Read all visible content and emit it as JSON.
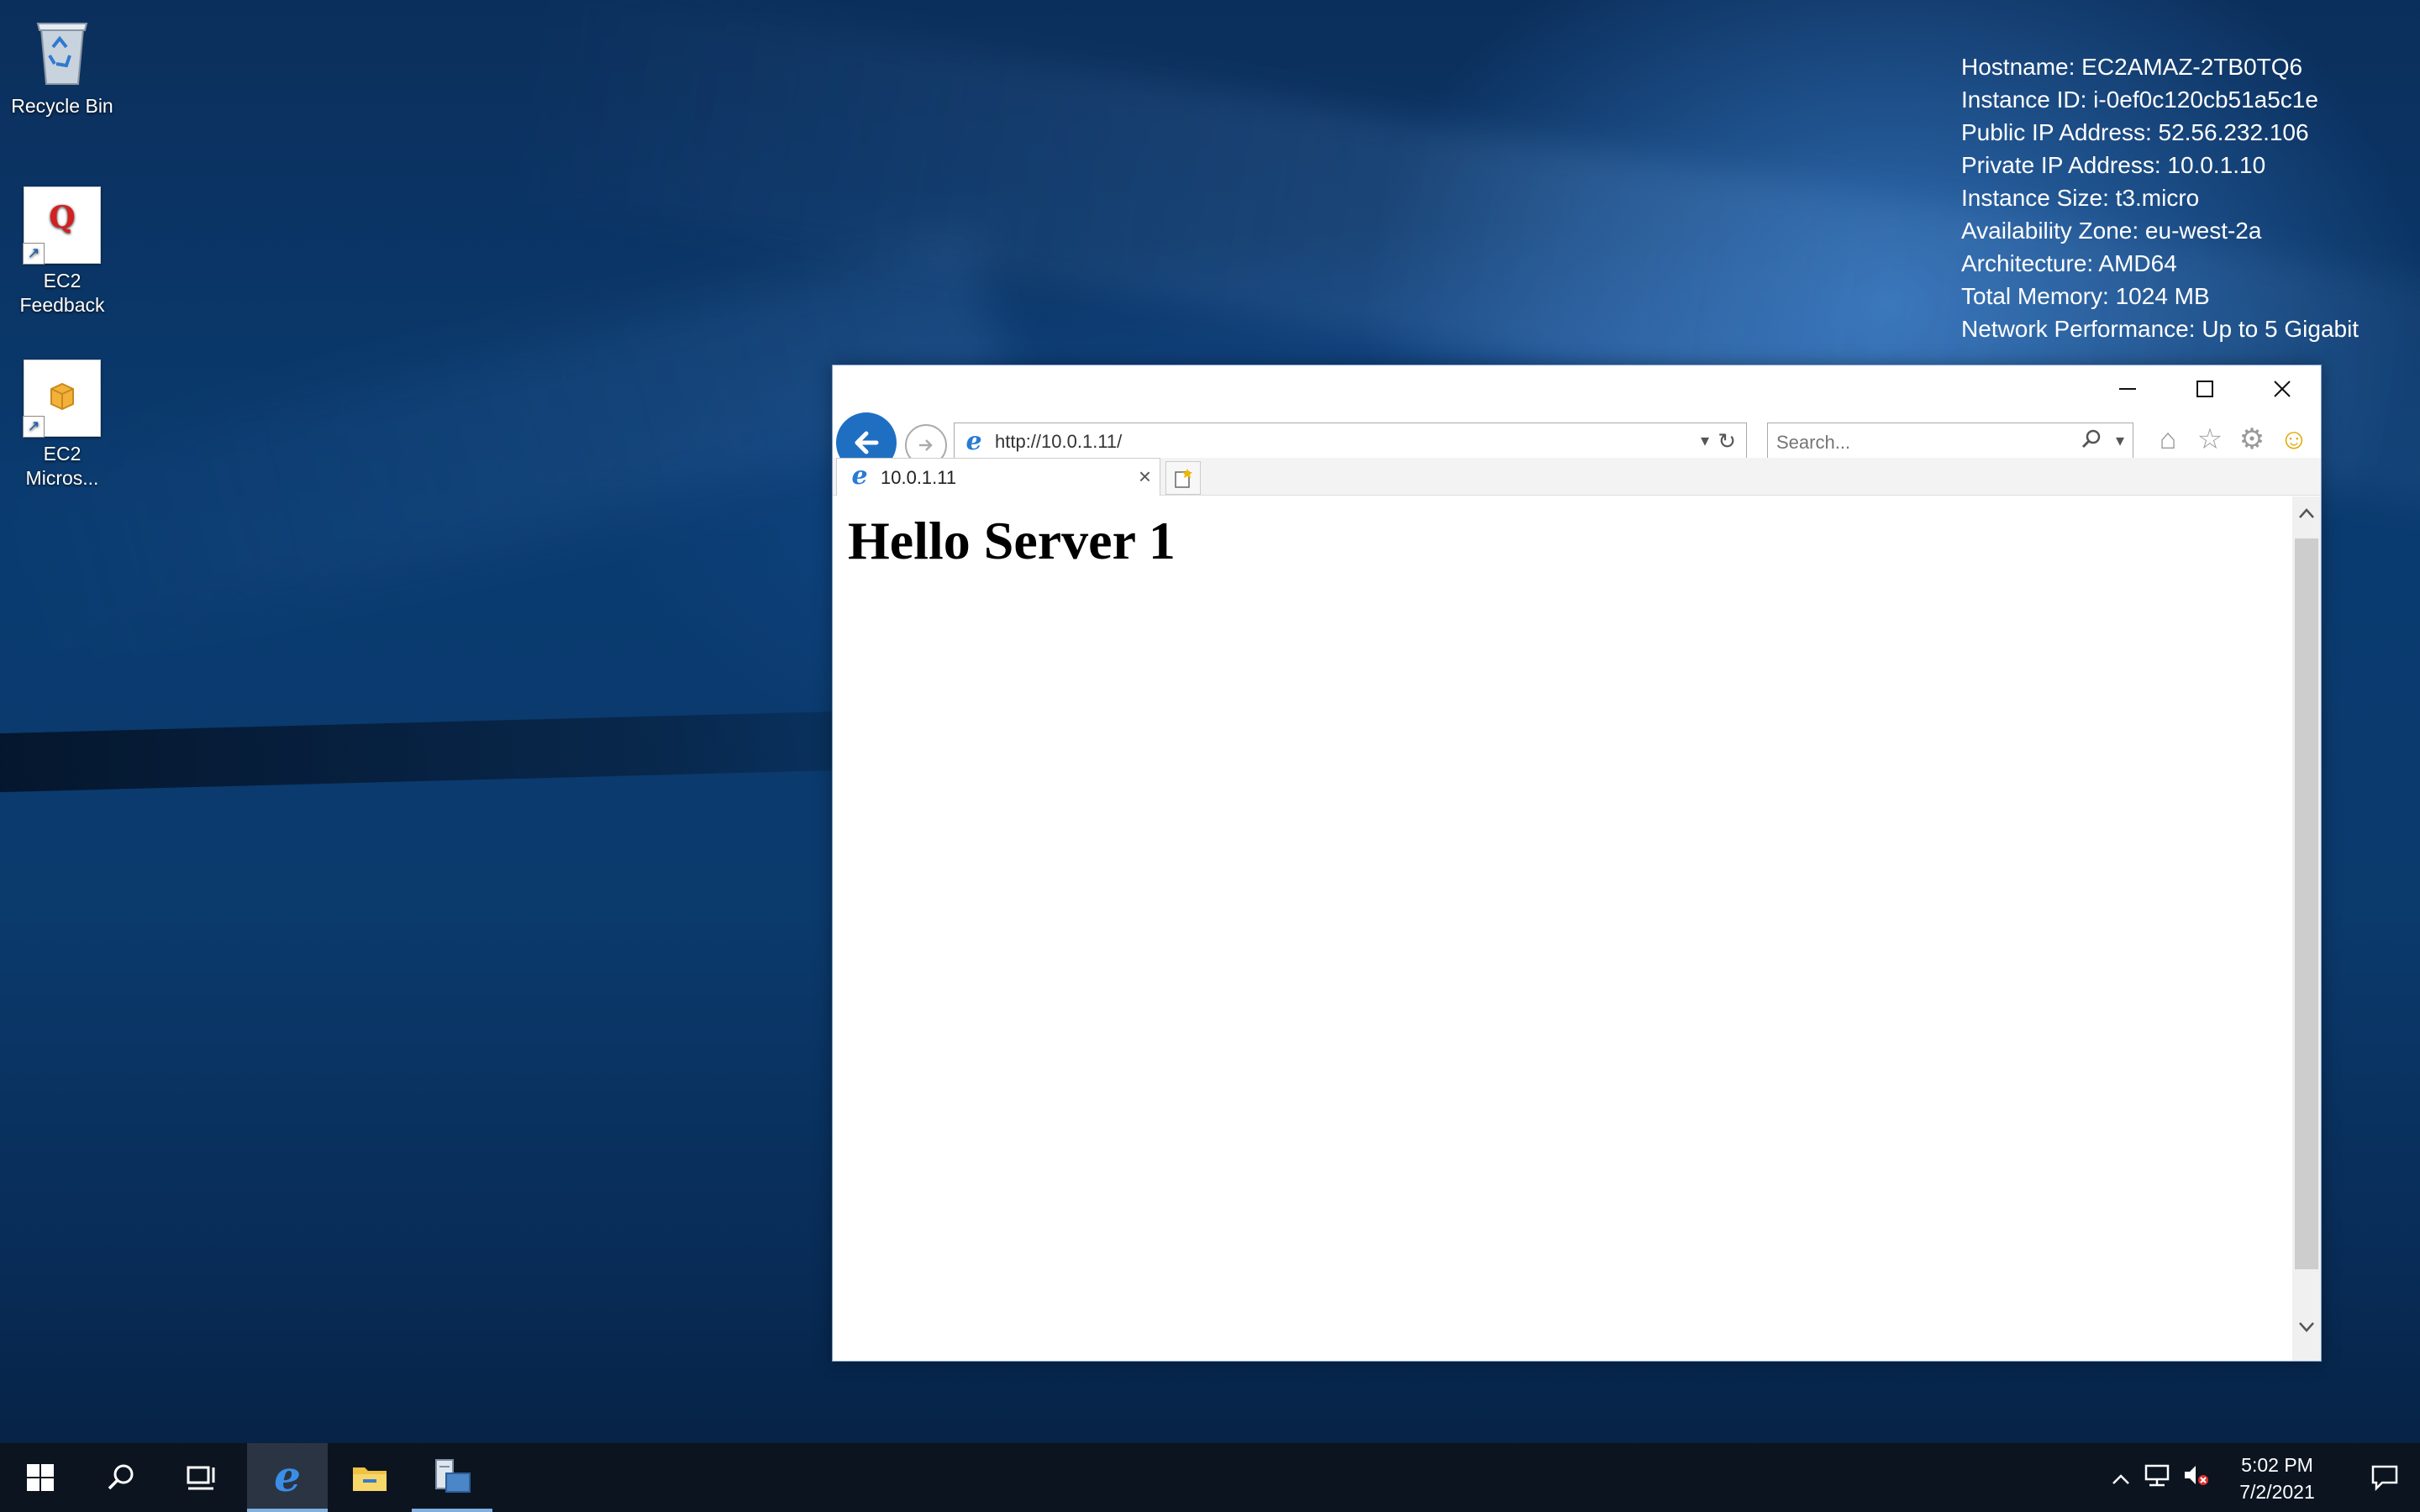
{
  "desktop": {
    "icons": [
      {
        "label": "Recycle Bin",
        "icon": "recycle-bin-icon"
      },
      {
        "label": "EC2\nFeedback",
        "icon": "ec2-feedback-icon",
        "glyph": "Q"
      },
      {
        "label": "EC2\nMicros...",
        "icon": "ec2-microsoft-icon"
      }
    ]
  },
  "sysinfo": {
    "lines": [
      "Hostname: EC2AMAZ-2TB0TQ6",
      "Instance ID: i-0ef0c120cb51a5c1e",
      "Public IP Address: 52.56.232.106",
      "Private IP Address: 10.0.1.10",
      "Instance Size: t3.micro",
      "Availability Zone: eu-west-2a",
      "Architecture: AMD64",
      "Total Memory: 1024 MB",
      "Network Performance: Up to 5 Gigabit"
    ]
  },
  "browser": {
    "address": "http://10.0.1.11/",
    "search_placeholder": "Search...",
    "tab_title": "10.0.1.11",
    "page_heading": "Hello Server 1",
    "accent": "#1e6fc2"
  },
  "taskbar": {
    "time": "5:02 PM",
    "date": "7/2/2021"
  }
}
